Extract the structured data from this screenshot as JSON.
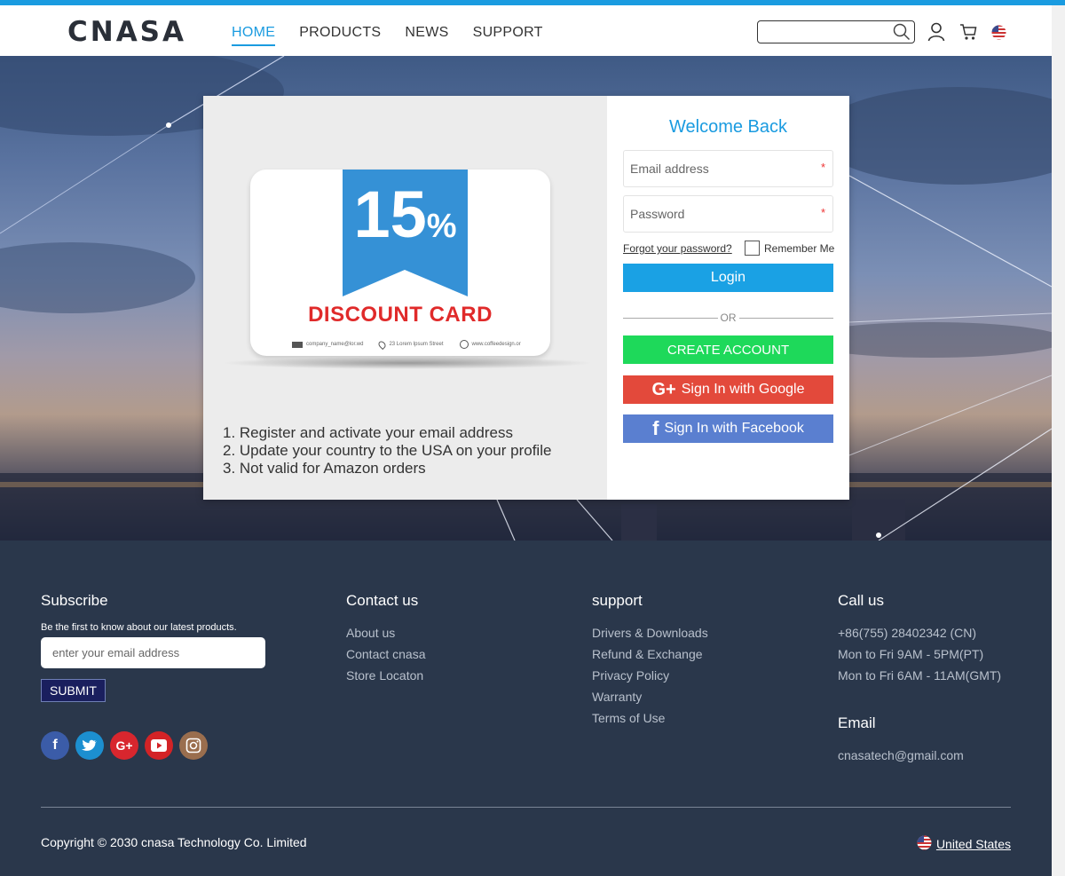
{
  "brand": {
    "logo_text": "CNASA"
  },
  "nav": {
    "items": [
      "HOME",
      "PRODUCTS",
      "NEWS",
      "SUPPORT"
    ],
    "active": "HOME"
  },
  "search": {
    "placeholder": ""
  },
  "icons": {
    "search": "search-icon",
    "account": "user-icon",
    "cart": "cart-icon",
    "flag": "us-flag-icon"
  },
  "promo": {
    "percent": "15",
    "percent_sign": "%",
    "card_title": "DISCOUNT CARD",
    "card_footer": [
      "company_name@lor.wd",
      "23 Lorem Ipsum Street",
      "www.coffeedesign.or"
    ],
    "steps": [
      "1. Register and activate your email address",
      "2. Update your country to the USA on your profile",
      "3. Not valid for Amazon orders"
    ]
  },
  "login": {
    "title": "Welcome Back",
    "email_placeholder": "Email address",
    "password_placeholder": "Password",
    "required_mark": "*",
    "forgot": "Forgot your password?",
    "remember": "Remember Me",
    "login_btn": "Login",
    "or": "OR",
    "create_btn": "CREATE ACCOUNT",
    "google_btn": "Sign In with Google",
    "facebook_btn": "Sign In with Facebook"
  },
  "footer": {
    "subscribe": {
      "title": "Subscribe",
      "text": "Be the first to know about our latest products.",
      "placeholder": "enter your email address",
      "button": "SUBMIT"
    },
    "contact": {
      "title": "Contact us",
      "links": [
        "About us",
        "Contact cnasa",
        "Store Locaton"
      ]
    },
    "support": {
      "title": "support",
      "links": [
        "Drivers & Downloads",
        "Refund & Exchange",
        "Privacy Policy",
        "Warranty",
        "Terms of Use"
      ]
    },
    "call": {
      "title": "Call us",
      "lines": [
        "+86(755) 28402342  (CN)",
        "Mon to Fri 9AM - 5PM(PT)",
        "Mon to Fri 6AM - 11AM(GMT)"
      ]
    },
    "email": {
      "title": "Email",
      "address": "cnasatech@gmail.com"
    },
    "social": [
      "facebook-icon",
      "twitter-icon",
      "google-plus-icon",
      "youtube-icon",
      "instagram-icon"
    ],
    "copyright": "Copyright © 2030 cnasa Technology Co. Limited",
    "region": "United States"
  },
  "colors": {
    "accent": "#1a9be0",
    "login": "#1aa1e4",
    "create": "#1ed95a",
    "google": "#e3493b",
    "facebook": "#5a7fd0",
    "footer_bg": "#2a374b",
    "discount_red": "#e02a2a"
  }
}
